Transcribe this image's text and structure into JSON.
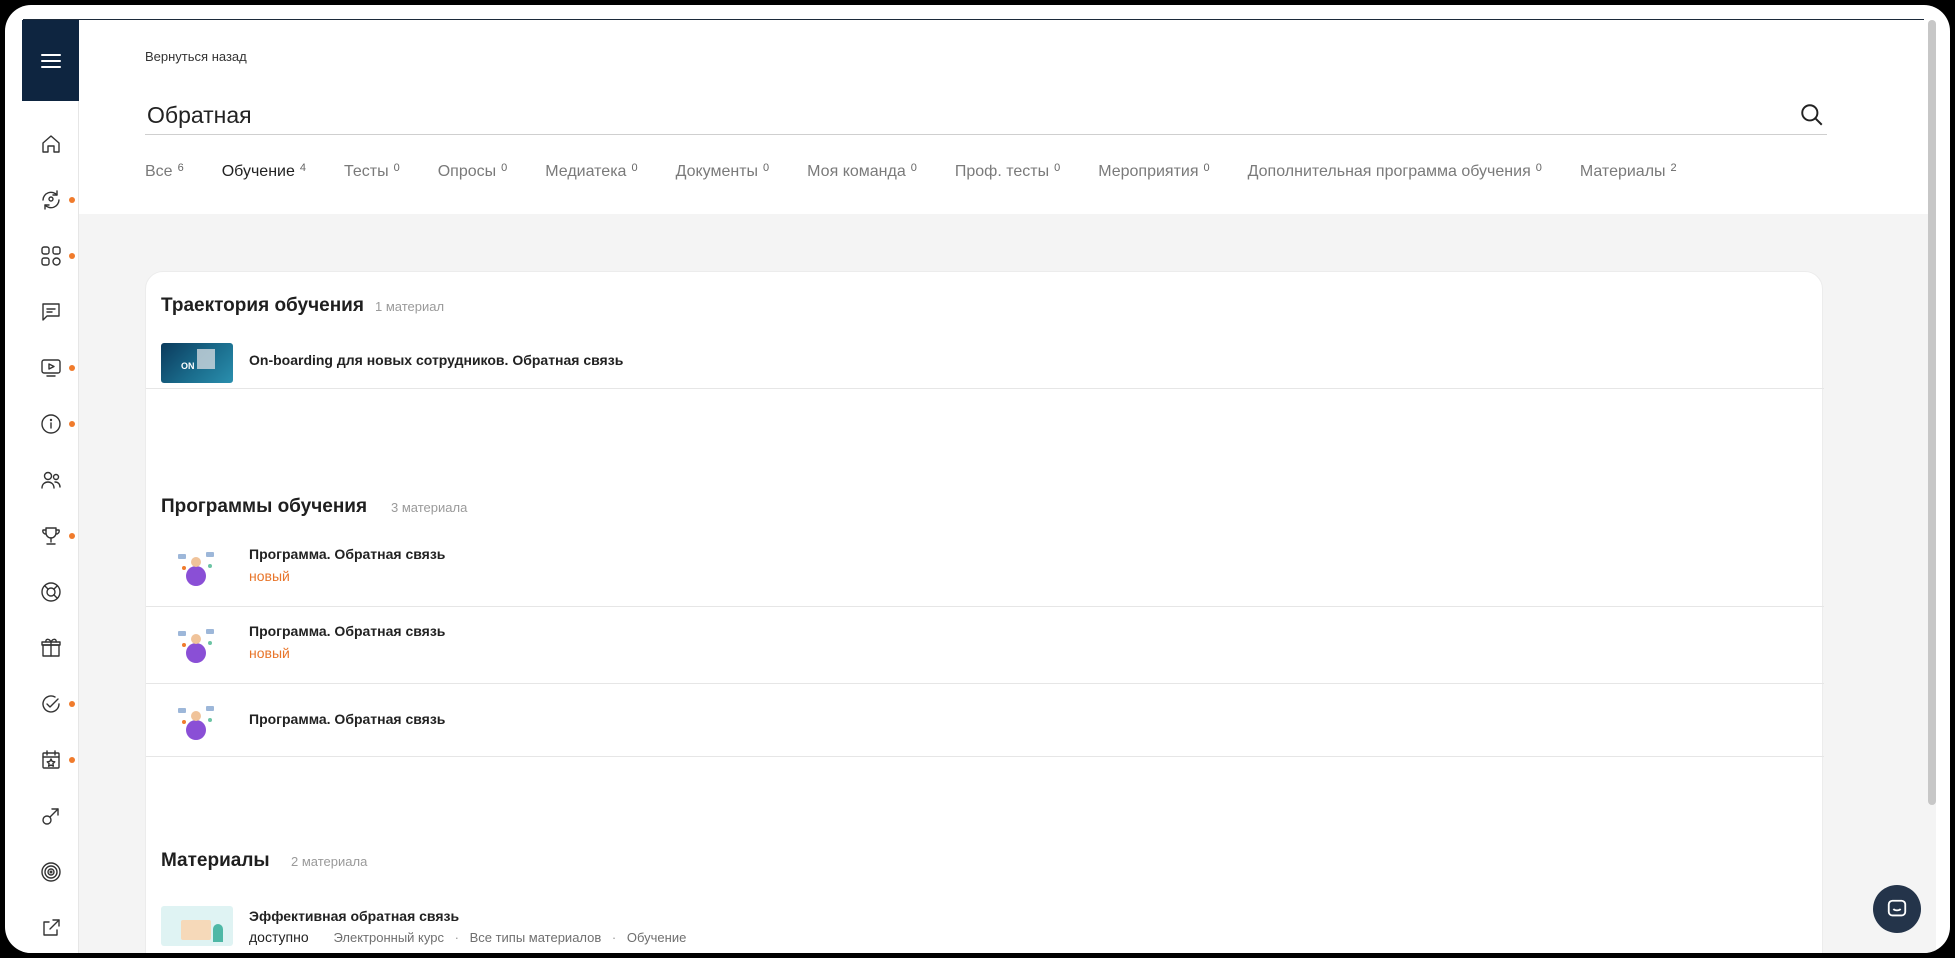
{
  "header": {
    "back_label": "Вернуться назад",
    "search_value": "Обратная"
  },
  "tabs": [
    {
      "label": "Все",
      "count": "6"
    },
    {
      "label": "Обучение",
      "count": "4"
    },
    {
      "label": "Тесты",
      "count": "0"
    },
    {
      "label": "Опросы",
      "count": "0"
    },
    {
      "label": "Медиатека",
      "count": "0"
    },
    {
      "label": "Документы",
      "count": "0"
    },
    {
      "label": "Моя команда",
      "count": "0"
    },
    {
      "label": "Проф. тесты",
      "count": "0"
    },
    {
      "label": "Мероприятия",
      "count": "0"
    },
    {
      "label": "Дополнительная программа обучения",
      "count": "0"
    },
    {
      "label": "Материалы",
      "count": "2"
    }
  ],
  "active_tab": "Обучение",
  "sidebar": {
    "icons": [
      {
        "name": "home-icon",
        "dot": false
      },
      {
        "name": "refresh-person-icon",
        "dot": true
      },
      {
        "name": "apps-icon",
        "dot": true
      },
      {
        "name": "chat-icon",
        "dot": false
      },
      {
        "name": "screen-play-icon",
        "dot": true
      },
      {
        "name": "info-icon",
        "dot": true
      },
      {
        "name": "users-icon",
        "dot": false
      },
      {
        "name": "trophy-icon",
        "dot": true
      },
      {
        "name": "lifebuoy-icon",
        "dot": false
      },
      {
        "name": "gift-icon",
        "dot": false
      },
      {
        "name": "check-circle-icon",
        "dot": true
      },
      {
        "name": "calendar-star-icon",
        "dot": true
      },
      {
        "name": "arrow-diagonal-icon",
        "dot": false
      },
      {
        "name": "target-icon",
        "dot": false
      },
      {
        "name": "external-link-icon",
        "dot": false
      }
    ],
    "dot_color": "#f07b2c",
    "menu_bg": "#0e2540"
  },
  "sections": {
    "trajectory": {
      "title": "Траектория обучения",
      "count": "1 материал",
      "items": [
        {
          "title": "On-boarding для новых сотрудников. Обратная связь",
          "thumb_text": "ON"
        }
      ]
    },
    "programs": {
      "title": "Программы обучения",
      "count": "3 материала",
      "items": [
        {
          "title": "Программа. Обратная связь",
          "status": "новый"
        },
        {
          "title": "Программа. Обратная связь",
          "status": "новый"
        },
        {
          "title": "Программа. Обратная связь",
          "status": ""
        }
      ]
    },
    "materials": {
      "title": "Материалы",
      "count": "2 материала",
      "items": [
        {
          "title": "Эффективная обратная связь",
          "availability": "доступно",
          "meta": [
            "Электронный курс",
            "Все типы материалов",
            "Обучение"
          ]
        }
      ]
    }
  },
  "accent_color": "#e8752a"
}
